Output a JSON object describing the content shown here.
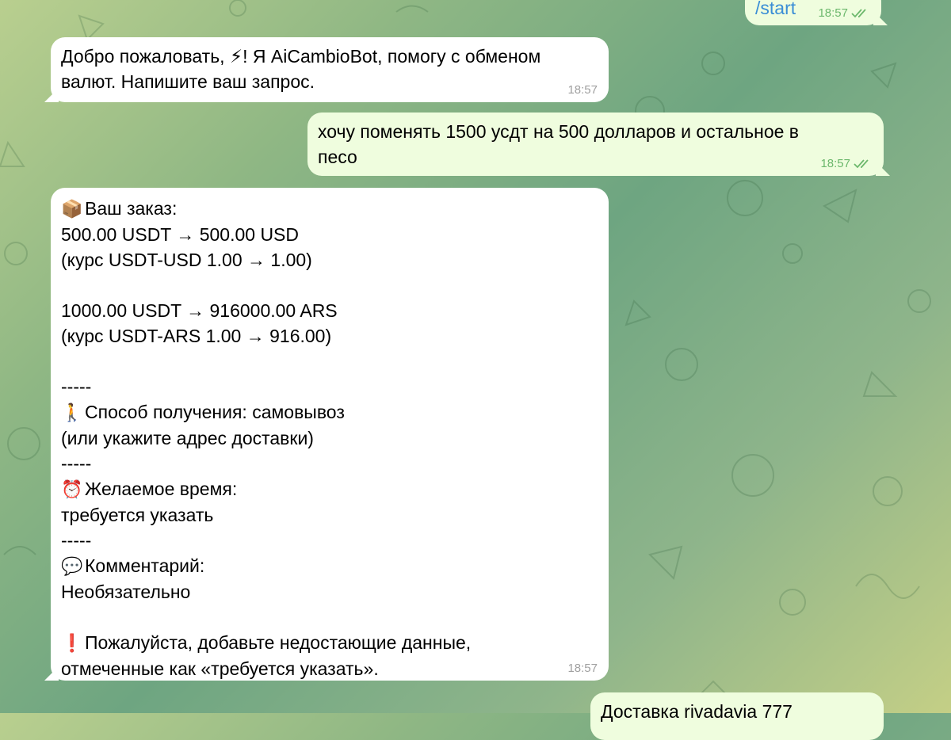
{
  "messages": {
    "m1": {
      "text": "/start",
      "time": "18:57"
    },
    "m2": {
      "lines": [
        "Добро пожаловать, ⚡! Я AiCambioBot, помогу с обменом",
        "валют. Напишите ваш запрос."
      ],
      "time": "18:57"
    },
    "m3": {
      "lines": [
        "хочу поменять 1500 усдт на 500 долларов и остальное в",
        "песо"
      ],
      "time": "18:57"
    },
    "m4": {
      "time": "18:57",
      "order_icon": "📦",
      "order_title": "Ваш заказ:",
      "conv1": "500.00 USDT → 500.00 USD",
      "rate1": "(курс USDT-USD 1.00 → 1.00)",
      "conv2": "1000.00 USDT → 916000.00 ARS",
      "rate2": "(курс USDT-ARS 1.00 → 916.00)",
      "sep": "-----",
      "delivery_icon": "🚶",
      "delivery": "Способ получения: самовывоз",
      "delivery_note": "(или укажите адрес доставки)",
      "time_icon": "⏰",
      "time_title": "Желаемое время:",
      "time_value": "требуется указать",
      "comment_icon": "💬",
      "comment_title": "Комментарий:",
      "comment_value": "Необязательно",
      "warn_icon": "❗",
      "warn1": "Пожалуйста, добавьте недостающие данные,",
      "warn2": "отмеченные как «требуется указать»."
    },
    "m5": {
      "text": "Доставка rivadavia 777"
    }
  },
  "colors": {
    "incoming": "#ffffff",
    "outgoing": "#effdde",
    "time_out": "#6cb86c",
    "time_in": "#a0a0a0",
    "command": "#3a8ed6"
  }
}
